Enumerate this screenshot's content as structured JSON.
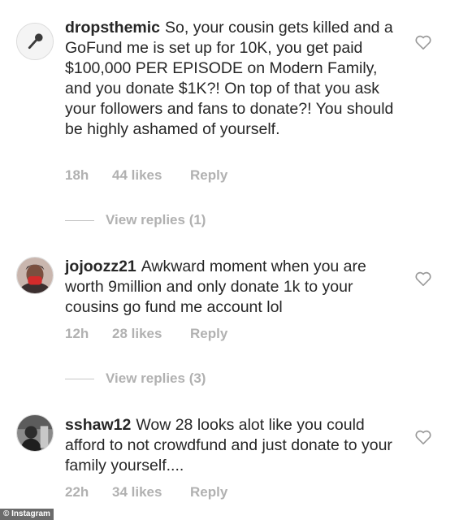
{
  "comments": [
    {
      "username": "dropsthemic",
      "text": "So, your cousin gets killed and a GoFund me is set up for 10K, you get paid $100,000 PER EPISODE on Modern Family, and you donate $1K?! On top of that you ask your followers and fans to donate?! You should be highly ashamed of yourself.",
      "time": "18h",
      "likes": "44 likes",
      "reply": "Reply",
      "view_replies": "View replies (1)",
      "avatar_icon": "microphone-icon"
    },
    {
      "username": "jojoozz21",
      "text": "Awkward moment when you are worth 9million and only donate 1k to your cousins go fund me account lol",
      "time": "12h",
      "likes": "28 likes",
      "reply": "Reply",
      "view_replies": "View replies (3)",
      "avatar_icon": "profile-photo"
    },
    {
      "username": "sshaw12",
      "text": "Wow 28 looks alot like you could afford to not crowdfund and just donate to your family yourself....",
      "time": "22h",
      "likes": "34 likes",
      "reply": "Reply",
      "avatar_icon": "profile-photo"
    }
  ],
  "watermark": "© Instagram",
  "colors": {
    "text": "#262626",
    "meta": "#b1b1b1",
    "heart_stroke": "#9a9a9a"
  }
}
